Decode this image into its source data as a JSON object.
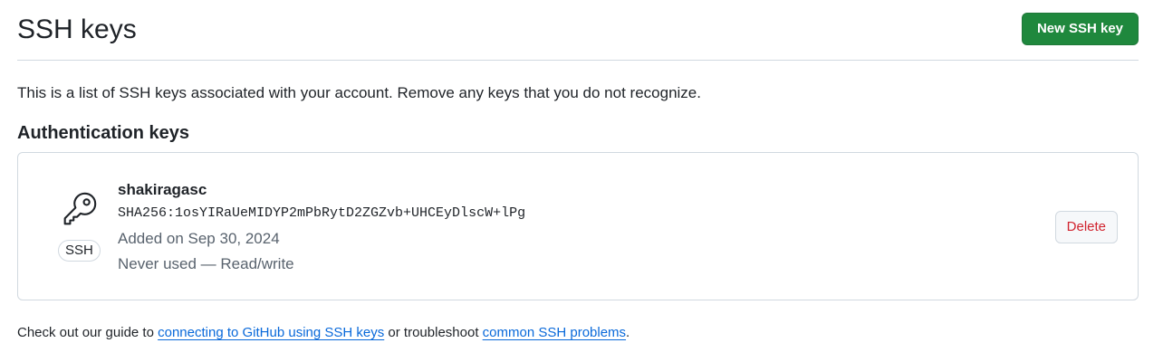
{
  "header": {
    "title": "SSH keys",
    "new_key_label": "New SSH key"
  },
  "intro": "This is a list of SSH keys associated with your account. Remove any keys that you do not recognize.",
  "section": {
    "title": "Authentication keys"
  },
  "keys": [
    {
      "icon": "key-icon",
      "badge": "SSH",
      "name": "shakiragasc",
      "fingerprint": "SHA256:1osYIRaUeMIDYP2mPbRytD2ZGZvb+UHCEyDlscW+lPg",
      "added": "Added on Sep 30, 2024",
      "usage": "Never used — Read/write",
      "delete_label": "Delete"
    }
  ],
  "footer": {
    "prefix": "Check out our guide to ",
    "link1": "connecting to GitHub using SSH keys",
    "middle": " or troubleshoot ",
    "link2": "common SSH problems",
    "suffix": "."
  },
  "colors": {
    "primary_button": "#1f883d",
    "danger_text": "#d1242f",
    "link": "#0969da",
    "border": "#d1d9e0",
    "muted_text": "#59636e"
  }
}
